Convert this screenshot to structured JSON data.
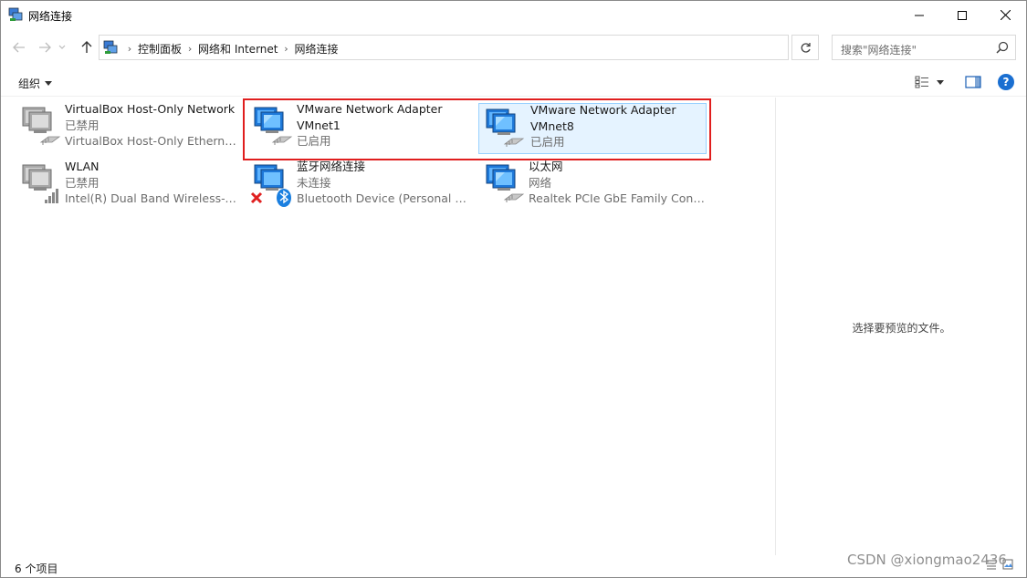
{
  "window": {
    "title": "网络连接"
  },
  "breadcrumbs": [
    "控制面板",
    "网络和 Internet",
    "网络连接"
  ],
  "search": {
    "placeholder": "搜索\"网络连接\""
  },
  "toolbar": {
    "organize_label": "组织"
  },
  "connections": [
    {
      "name": "VirtualBox Host-Only Network",
      "name2": "",
      "status": "已禁用",
      "device": "VirtualBox Host-Only Ethernet ...",
      "icon": "network-adapter-disabled-icon"
    },
    {
      "name": "VMware Network Adapter",
      "name2": "VMnet1",
      "status": "已启用",
      "device": "",
      "icon": "network-adapter-icon"
    },
    {
      "name": "VMware Network Adapter",
      "name2": "VMnet8",
      "status": "已启用",
      "device": "",
      "icon": "network-adapter-icon",
      "selected": true
    },
    {
      "name": "WLAN",
      "name2": "",
      "status": "已禁用",
      "device": "Intel(R) Dual Band Wireless-A...",
      "icon": "wifi-adapter-disabled-icon"
    },
    {
      "name": "蓝牙网络连接",
      "name2": "",
      "status": "未连接",
      "device": "Bluetooth Device (Personal Ar...",
      "icon": "bluetooth-adapter-icon"
    },
    {
      "name": "以太网",
      "name2": "",
      "status": "网络",
      "device": "Realtek PCIe GbE Family Contr...",
      "icon": "ethernet-adapter-icon"
    }
  ],
  "preview": {
    "message": "选择要预览的文件。"
  },
  "status": {
    "item_count": "6 个项目"
  },
  "watermark": "CSDN @xiongmao2436",
  "colors": {
    "highlight": "#e01e1e",
    "selection_bg": "#e5f3ff",
    "selection_border": "#99d1ff",
    "monitor_blue": "#1e78d8"
  }
}
